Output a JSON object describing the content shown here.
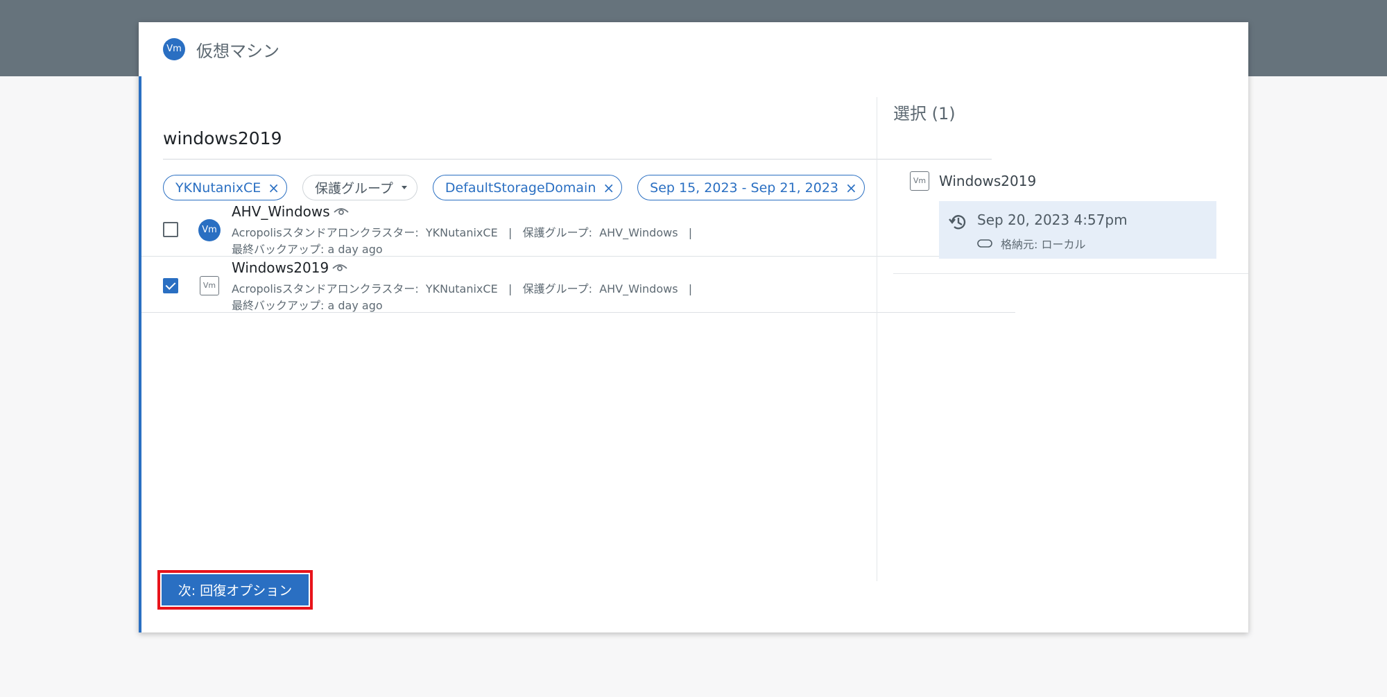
{
  "dialog": {
    "badge": "Vm",
    "title": "仮想マシン"
  },
  "search": {
    "value": "windows2019"
  },
  "filters": [
    {
      "label": "YKNutanixCE",
      "removable": true
    },
    {
      "label": "保護グループ",
      "dropdown": true
    },
    {
      "label": "DefaultStorageDomain",
      "removable": true
    },
    {
      "label": "Sep 15, 2023 - Sep 21, 2023",
      "removable": true
    }
  ],
  "icons": {
    "remove": "×",
    "vm_badge": "Vm"
  },
  "vms": [
    {
      "name": "AHV_Windows",
      "checked": false,
      "meta": "Acropolisスタンドアロンクラスター:  YKNutanixCE   |   保護グループ:  AHV_Windows   |",
      "backup": "最終バックアップ: a day ago"
    },
    {
      "name": "Windows2019",
      "checked": true,
      "meta": "Acropolisスタンドアロンクラスター:  YKNutanixCE   |   保護グループ:  AHV_Windows   |",
      "backup": "最終バックアップ: a day ago"
    }
  ],
  "selection": {
    "title": "選択 (1)",
    "vm_name": "Windows2019",
    "snapshot_time": "Sep 20, 2023 4:57pm",
    "location": "格納元: ローカル"
  },
  "footer": {
    "next_label": "次: 回復オプション"
  },
  "colors": {
    "accent": "#2a6fc2",
    "header_bg": "#66737c",
    "highlight": "#e8141b"
  }
}
